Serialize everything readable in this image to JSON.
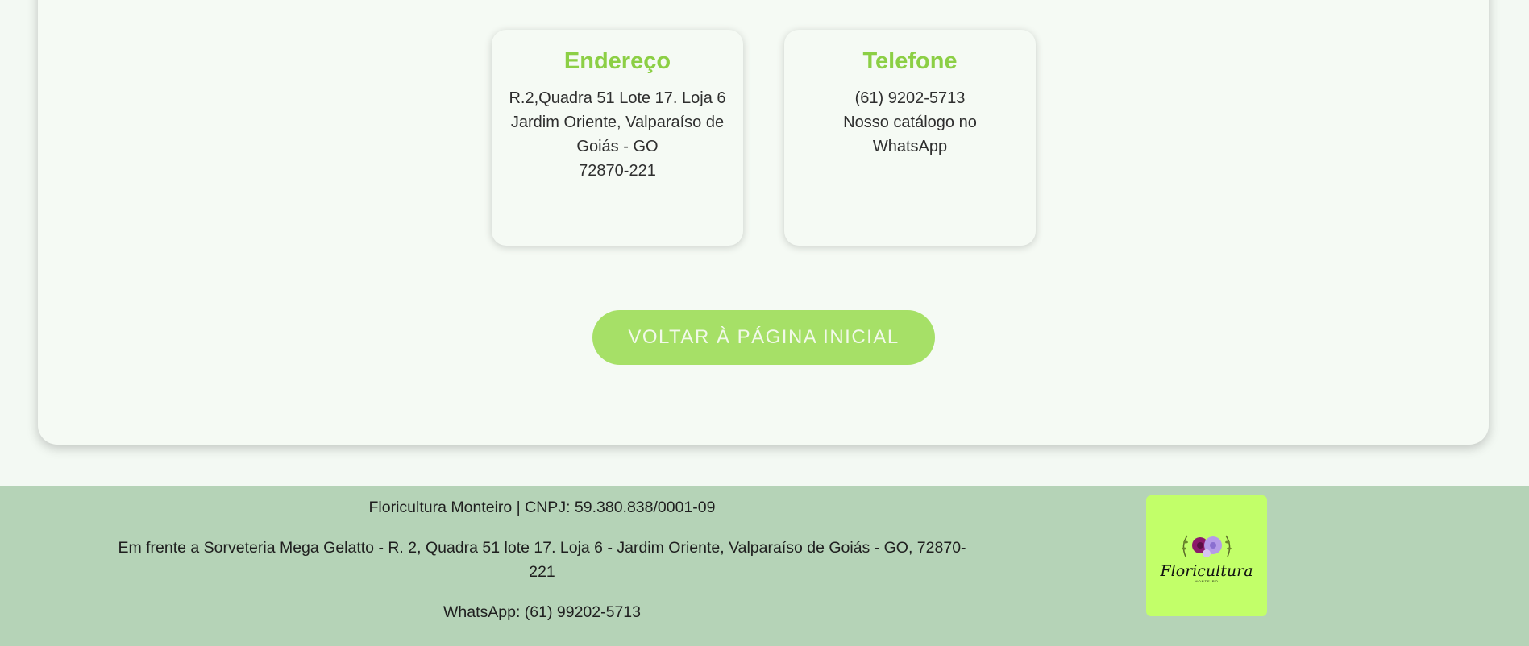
{
  "address_card": {
    "title": "Endereço",
    "lines": [
      "R.2,Quadra 51 Lote 17. Loja 6",
      "Jardim Oriente, Valparaíso de",
      "Goiás - GO",
      "72870-221"
    ]
  },
  "phone_card": {
    "title": "Telefone",
    "lines": [
      "(61) 9202-5713",
      "Nosso catálogo no",
      "WhatsApp"
    ]
  },
  "back_button": {
    "label": "VOLTAR À PÁGINA INICIAL"
  },
  "footer": {
    "company": "Floricultura Monteiro | CNPJ: 59.380.838/0001-09",
    "address": "Em frente a Sorveteria Mega Gelatto - R. 2, Quadra 51 lote 17. Loja 6 - Jardim Oriente, Valparaíso de Goiás - GO, 72870-221",
    "whatsapp": "WhatsApp: (61) 99202-5713",
    "logo": {
      "name": "Floricultura",
      "sub": "MONTEIRO"
    }
  },
  "colors": {
    "accent_green": "#8ccf45",
    "button": "#a6e067",
    "footer_bg": "#b5d3b7",
    "logo_bg": "#c2ff69"
  }
}
